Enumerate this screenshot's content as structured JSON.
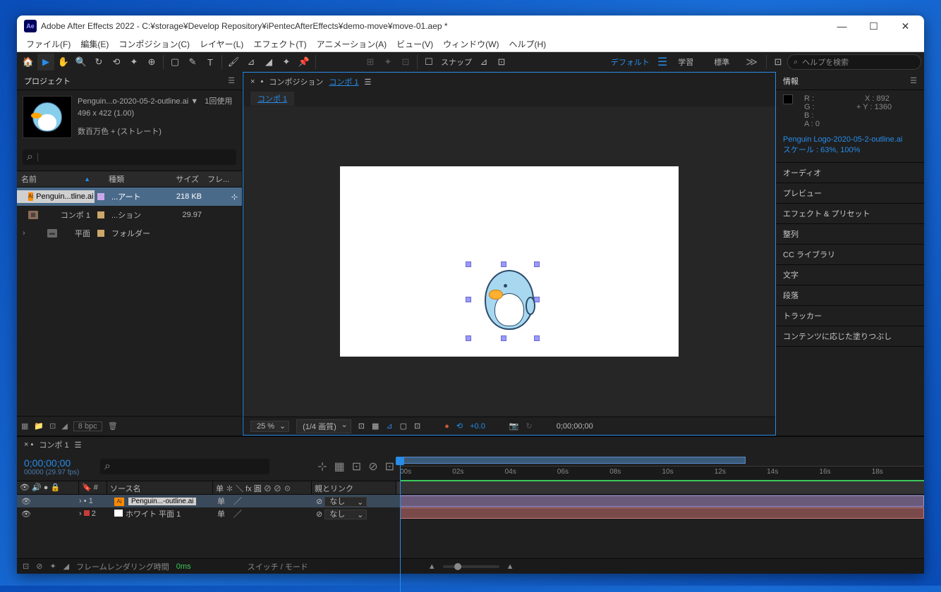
{
  "title": "Adobe After Effects 2022 - C:¥storage¥Develop Repository¥iPentecAfterEffects¥demo-move¥move-01.aep *",
  "menu": [
    "ファイル(F)",
    "編集(E)",
    "コンポジション(C)",
    "レイヤー(L)",
    "エフェクト(T)",
    "アニメーション(A)",
    "ビュー(V)",
    "ウィンドウ(W)",
    "ヘルプ(H)"
  ],
  "snap": "スナップ",
  "workspaces": {
    "default": "デフォルト",
    "learn": "学習",
    "standard": "標準"
  },
  "search_placeholder": "ヘルプを検索",
  "project": {
    "label": "プロジェクト",
    "filename": "Penguin...o-2020-05-2-outline.ai",
    "usage": "1回使用",
    "dims": "496 x 422 (1.00)",
    "colors": "数百万色 + (ストレート)",
    "cols": {
      "name": "名前",
      "type": "種類",
      "size": "サイズ",
      "rest": "フレ..."
    },
    "rows": [
      {
        "name": "Penguin...tline.ai",
        "type": "...アート",
        "size": "218 KB"
      },
      {
        "name": "コンポ 1",
        "type": "...ション",
        "size": "29.97"
      },
      {
        "name": "平面",
        "type": "フォルダー",
        "size": ""
      }
    ],
    "bpc": "8 bpc"
  },
  "comp": {
    "header": "コンポジション",
    "link": "コンポ 1",
    "subtab": "コンポ 1",
    "zoom": "25 %",
    "quality": "(1/4 画質)",
    "offset": "+0.0",
    "time": "0;00;00;00"
  },
  "info": {
    "label": "情報",
    "r": "R :",
    "g": "G :",
    "b": "B :",
    "a": "A :",
    "av": "0",
    "x": "X :",
    "xv": "892",
    "y": "Y :",
    "yv": "1360",
    "file": "Penguin Logo-2020-05-2-outline.ai",
    "scale": "スケール : 63%, 100%"
  },
  "accordions": [
    "オーディオ",
    "プレビュー",
    "エフェクト & プリセット",
    "整列",
    "CC ライブラリ",
    "文字",
    "段落",
    "トラッカー",
    "コンテンツに応じた塗りつぶし"
  ],
  "timeline": {
    "tab": "コンポ 1",
    "timecode": "0;00;00;00",
    "fps": "00000 (29.97 fps)",
    "cols": {
      "num": "#",
      "source": "ソース名",
      "switches": "单 ✽ ＼ fx 圓 ⊘ ⊘ ☉",
      "parent": "親とリンク"
    },
    "layers": [
      {
        "num": "1",
        "name": "Penguin...-outline.ai",
        "parent": "なし"
      },
      {
        "num": "2",
        "name": "ホワイト 平面 1",
        "parent": "なし"
      }
    ],
    "marks": [
      "00s",
      "02s",
      "04s",
      "06s",
      "08s",
      "10s",
      "12s",
      "14s",
      "16s",
      "18s"
    ],
    "footer": "フレームレンダリング時間",
    "ms": "0ms",
    "switch": "スイッチ / モード"
  }
}
